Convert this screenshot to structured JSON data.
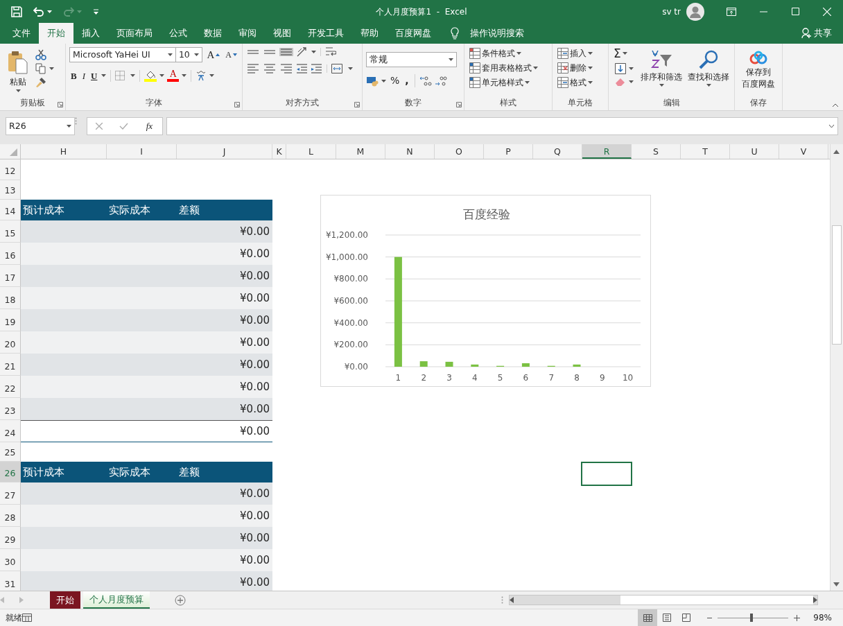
{
  "window": {
    "title": "个人月度预算1  -  Excel",
    "user": "sv tr"
  },
  "ribbon_tabs": [
    {
      "label": "文件",
      "selected": false
    },
    {
      "label": "开始",
      "selected": true
    },
    {
      "label": "插入",
      "selected": false
    },
    {
      "label": "页面布局",
      "selected": false
    },
    {
      "label": "公式",
      "selected": false
    },
    {
      "label": "数据",
      "selected": false
    },
    {
      "label": "审阅",
      "selected": false
    },
    {
      "label": "视图",
      "selected": false
    },
    {
      "label": "开发工具",
      "selected": false
    },
    {
      "label": "帮助",
      "selected": false
    },
    {
      "label": "百度网盘",
      "selected": false
    }
  ],
  "tell_me": "操作说明搜索",
  "share": "共享",
  "clipboard": {
    "paste": "粘贴",
    "label": "剪贴板"
  },
  "font": {
    "name": "Microsoft YaHei UI",
    "size": "10",
    "grow": "A",
    "shrink": "A",
    "bold": "B",
    "italic": "I",
    "underline": "U",
    "color_letter": "A",
    "label": "字体"
  },
  "alignment": {
    "label": "对齐方式"
  },
  "number": {
    "format": "常规",
    "percent": "%",
    "comma": ",",
    "label": "数字"
  },
  "styles": {
    "items": [
      "条件格式",
      "套用表格格式",
      "单元格样式"
    ],
    "label": "样式"
  },
  "cells": {
    "items": [
      "插入",
      "删除",
      "格式"
    ],
    "label": "单元格"
  },
  "editing": {
    "sum": "Σ",
    "sort": "排序和筛选",
    "find": "查找和选择",
    "label": "编辑"
  },
  "save": {
    "button": [
      "保存到",
      "百度网盘"
    ],
    "label": "保存"
  },
  "formula_bar": {
    "name_box": "R26",
    "function_button": "fx"
  },
  "columns": [
    {
      "label": "H",
      "selected": false
    },
    {
      "label": "I",
      "selected": false
    },
    {
      "label": "J",
      "selected": false
    },
    {
      "label": "K",
      "selected": false
    },
    {
      "label": "L",
      "selected": false
    },
    {
      "label": "M",
      "selected": false
    },
    {
      "label": "N",
      "selected": false
    },
    {
      "label": "O",
      "selected": false
    },
    {
      "label": "P",
      "selected": false
    },
    {
      "label": "Q",
      "selected": false
    },
    {
      "label": "R",
      "selected": true
    },
    {
      "label": "S",
      "selected": false
    },
    {
      "label": "T",
      "selected": false
    },
    {
      "label": "U",
      "selected": false
    },
    {
      "label": "V",
      "selected": false
    }
  ],
  "rows": [
    {
      "number": "12",
      "kind": "blank",
      "selected": false
    },
    {
      "number": "13",
      "kind": "blank",
      "selected": false
    },
    {
      "number": "14",
      "kind": "header",
      "cells": [
        "预计成本",
        "实际成本",
        "差额"
      ],
      "selected": false
    },
    {
      "number": "15",
      "kind": "data",
      "amount": "¥0.00",
      "selected": false
    },
    {
      "number": "16",
      "kind": "data",
      "amount": "¥0.00",
      "selected": false
    },
    {
      "number": "17",
      "kind": "data",
      "amount": "¥0.00",
      "selected": false
    },
    {
      "number": "18",
      "kind": "data",
      "amount": "¥0.00",
      "selected": false
    },
    {
      "number": "19",
      "kind": "data",
      "amount": "¥0.00",
      "selected": false
    },
    {
      "number": "20",
      "kind": "data",
      "amount": "¥0.00",
      "selected": false
    },
    {
      "number": "21",
      "kind": "data",
      "amount": "¥0.00",
      "selected": false
    },
    {
      "number": "22",
      "kind": "data",
      "amount": "¥0.00",
      "selected": false
    },
    {
      "number": "23",
      "kind": "data",
      "amount": "¥0.00",
      "selected": false
    },
    {
      "number": "24",
      "kind": "total",
      "amount": "¥0.00",
      "selected": false
    },
    {
      "number": "25",
      "kind": "blank",
      "selected": false
    },
    {
      "number": "26",
      "kind": "header",
      "cells": [
        "预计成本",
        "实际成本",
        "差额"
      ],
      "selected": true
    },
    {
      "number": "27",
      "kind": "data",
      "amount": "¥0.00",
      "selected": false
    },
    {
      "number": "28",
      "kind": "data",
      "amount": "¥0.00",
      "selected": false
    },
    {
      "number": "29",
      "kind": "data",
      "amount": "¥0.00",
      "selected": false
    },
    {
      "number": "30",
      "kind": "data",
      "amount": "¥0.00",
      "selected": false
    },
    {
      "number": "31",
      "kind": "data",
      "amount": "¥0.00",
      "selected": false
    }
  ],
  "chart": {
    "chart_data": {
      "type": "bar",
      "title": "百度经验",
      "categories": [
        "1",
        "2",
        "3",
        "4",
        "5",
        "6",
        "7",
        "8",
        "9",
        "10"
      ],
      "series": [
        {
          "color": "#7bc143",
          "values": [
            1000,
            50,
            45,
            20,
            8,
            32,
            8,
            20,
            0,
            0
          ]
        }
      ],
      "ylim": [
        0,
        1200
      ],
      "grid": true,
      "yticks": [
        {
          "value": 0,
          "label": "¥0.00"
        },
        {
          "value": 200,
          "label": "¥200.00"
        },
        {
          "value": 400,
          "label": "¥400.00"
        },
        {
          "value": 600,
          "label": "¥600.00"
        },
        {
          "value": 800,
          "label": "¥800.00"
        },
        {
          "value": 1000,
          "label": "¥1,000.00"
        },
        {
          "value": 1200,
          "label": "¥1,200.00"
        }
      ]
    }
  },
  "sheet_tabs": [
    {
      "label": "开始",
      "selected": false,
      "color": "#7b1521"
    },
    {
      "label": "个人月度预算",
      "selected": true
    }
  ],
  "status_bar": {
    "status": "就绪",
    "zoom": "98%",
    "zoom_slider": {
      "level": 0.48
    }
  }
}
